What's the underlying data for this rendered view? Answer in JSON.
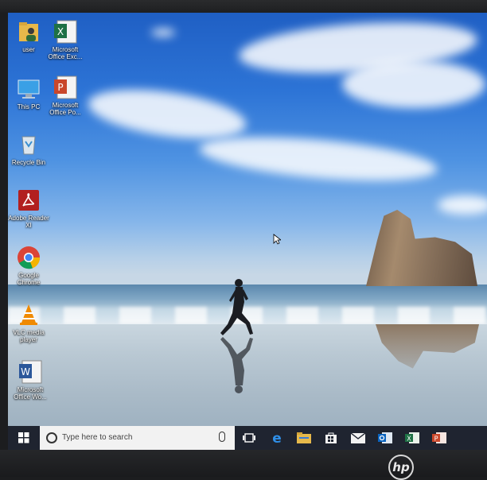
{
  "desktop": {
    "icons": [
      {
        "label": "user",
        "icon": "user-folder-icon"
      },
      {
        "label": "Microsoft Office Exc...",
        "icon": "excel-icon"
      },
      {
        "label": "This PC",
        "icon": "this-pc-icon"
      },
      {
        "label": "Microsoft Office Po...",
        "icon": "powerpoint-icon"
      },
      {
        "label": "Recycle Bin",
        "icon": "recycle-bin-icon"
      },
      {
        "label": "Adobe Reader XI",
        "icon": "adobe-reader-icon"
      },
      {
        "label": "Google Chrome",
        "icon": "chrome-icon"
      },
      {
        "label": "VLC media player",
        "icon": "vlc-icon"
      },
      {
        "label": "Microsoft Office Wo...",
        "icon": "word-icon"
      }
    ]
  },
  "taskbar": {
    "search_placeholder": "Type here to search",
    "pinned": [
      "task-view-icon",
      "edge-icon",
      "file-explorer-icon",
      "store-icon",
      "mail-icon",
      "outlook-icon",
      "excel-icon",
      "powerpoint-icon"
    ]
  },
  "colors": {
    "taskbar": "#1f2430",
    "sky": "#2d74d6"
  },
  "monitor": {
    "brand": "hp"
  }
}
